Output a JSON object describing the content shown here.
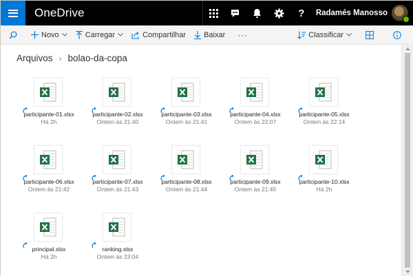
{
  "app": {
    "title": "OneDrive",
    "user_name": "Radamés Manosso"
  },
  "header": {
    "icons": [
      "app-launcher-icon",
      "feedback-icon",
      "bell-icon",
      "gear-icon",
      "help-icon"
    ],
    "help_glyph": "?"
  },
  "toolbar": {
    "new_label": "Novo",
    "upload_label": "Carregar",
    "share_label": "Compartilhar",
    "download_label": "Baixar",
    "more_label": "···",
    "sort_label": "Classificar"
  },
  "breadcrumb": {
    "root": "Arquivos",
    "separator": "›",
    "current": "bolao-da-copa"
  },
  "files": [
    {
      "name": "participante-01.xlsx",
      "modified": "Há 2h"
    },
    {
      "name": "participante-02.xlsx",
      "modified": "Ontem às 21:40"
    },
    {
      "name": "participante-03.xlsx",
      "modified": "Ontem às 21:41"
    },
    {
      "name": "participante-04.xlsx",
      "modified": "Ontem às 22:07"
    },
    {
      "name": "participante-05.xlsx",
      "modified": "Ontem às 22:14"
    },
    {
      "name": "participante-06.xlsx",
      "modified": "Ontem às 21:42"
    },
    {
      "name": "participante-07.xlsx",
      "modified": "Ontem às 21:43"
    },
    {
      "name": "participante-08.xlsx",
      "modified": "Ontem às 21:44"
    },
    {
      "name": "participante-09.xlsx",
      "modified": "Ontem às 21:45"
    },
    {
      "name": "participante-10.xlsx",
      "modified": "Há 2h"
    },
    {
      "name": "principal.xlsx",
      "modified": "Há 2h"
    },
    {
      "name": "ranking.xlsx",
      "modified": "Ontem às 23:04"
    }
  ],
  "colors": {
    "brand_blue": "#0078d4",
    "excel_green": "#217346",
    "header_bg": "#000000",
    "presence_green": "#6bb700"
  }
}
